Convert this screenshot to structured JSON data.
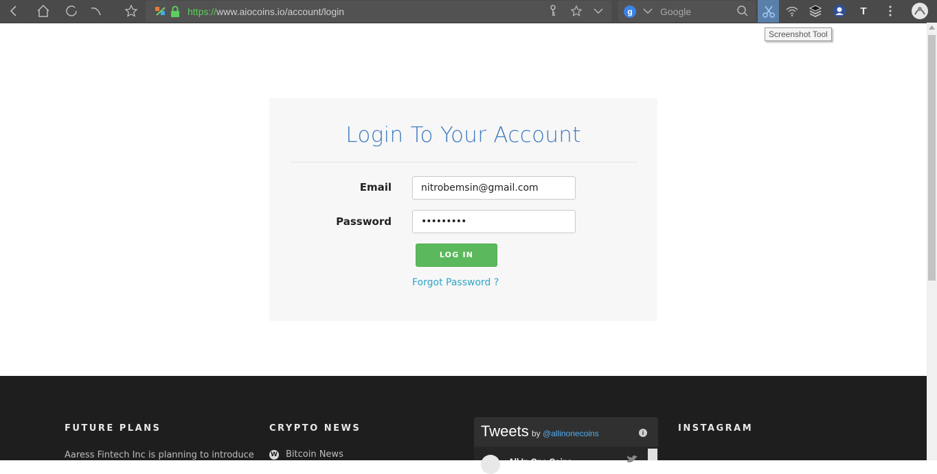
{
  "browser": {
    "url_scheme": "https://",
    "url_rest": "www.aiocoins.io/account/login",
    "search_engine_badge": "g",
    "search_placeholder": "Google",
    "tooltip": "Screenshot Tool",
    "t_button": "T"
  },
  "login": {
    "title": "Login To Your Account",
    "email_label": "Email",
    "email_value": "nitrobemsin@gmail.com",
    "password_label": "Password",
    "password_value": "•••••••••",
    "login_button": "LOG IN",
    "forgot_link": "Forgot Password ?"
  },
  "footer": {
    "future_plans_heading": "FUTURE PLANS",
    "future_plans_text": "Aaress Fintech Inc is planning to introduce",
    "crypto_news_heading": "CRYPTO NEWS",
    "news_items": [
      "Bitcoin News"
    ],
    "tweets_title": "Tweets",
    "tweets_by": "by ",
    "tweets_handle": "@allinonecoins",
    "tweet_author": "All In One Coins",
    "instagram_heading": "INSTAGRAM"
  },
  "colors": {
    "toolbar": "#4a4a4a",
    "title_blue": "#3f7bc0",
    "login_green": "#5cb85c",
    "link_teal": "#2ea5c6",
    "footer_bg": "#1e1e1e"
  }
}
